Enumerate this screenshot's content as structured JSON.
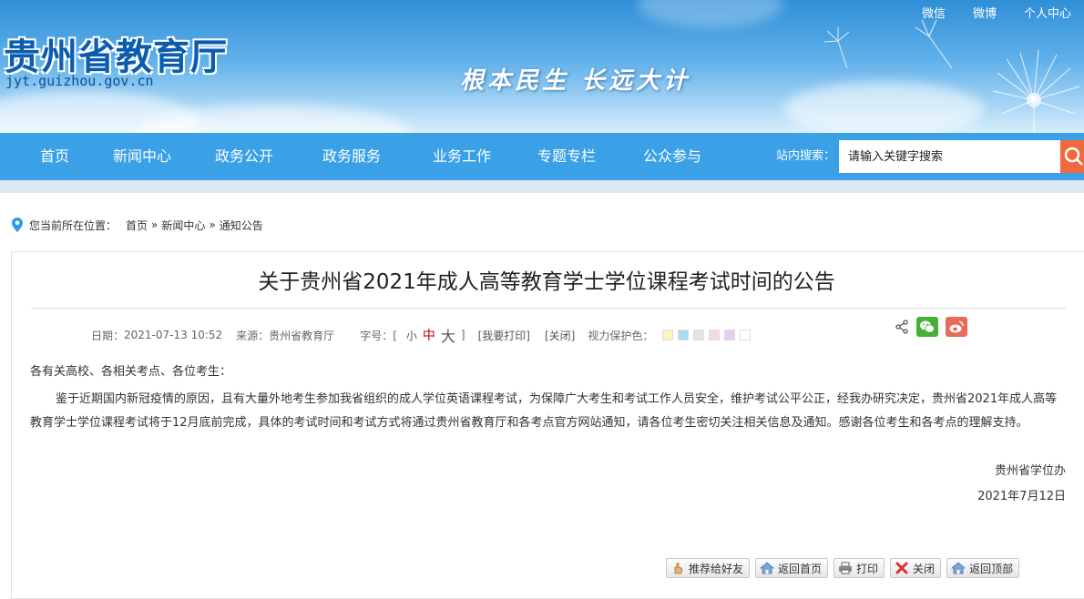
{
  "header": {
    "site_name": "贵州省教育厅",
    "site_domain": "jyt.guizhou.gov.cn",
    "slogan": "根本民生 长远大计",
    "top_links": [
      "微信",
      "微博",
      "个人中心"
    ]
  },
  "nav": {
    "items": [
      "首页",
      "新闻中心",
      "政务公开",
      "政务服务",
      "业务工作",
      "专题专栏",
      "公众参与"
    ],
    "search_label": "站内搜索：",
    "search_placeholder": "请输入关键字搜索"
  },
  "breadcrumb": {
    "prefix": "您当前所在位置：",
    "items": [
      "首页",
      "新闻中心",
      "通知公告"
    ],
    "separator": "»"
  },
  "article": {
    "title": "关于贵州省2021年成人高等教育学士学位课程考试时间的公告",
    "date_label": "日期：",
    "date": "2021-07-13 10:52",
    "source_label": "来源：",
    "source": "贵州省教育厅",
    "font_label": "字号：[",
    "font_small": "小",
    "font_medium": "中",
    "font_large": "大",
    "font_close": "]",
    "print_label": "[我要打印]",
    "close_label": "[关闭]",
    "eye_label": "视力保护色：",
    "eye_colors": [
      "#fbf3c0",
      "#a8ddf2",
      "#e3e3e3",
      "#f6d9e0",
      "#e6cdf2",
      "#ffffff"
    ],
    "greeting": "各有关高校、各相关考点、各位考生：",
    "paragraph": "鉴于近期国内新冠疫情的原因，且有大量外地考生参加我省组织的成人学位英语课程考试，为保障广大考生和考试工作人员安全，维护考试公平公正，经我办研究决定，贵州省2021年成人高等教育学士学位课程考试将于12月底前完成，具体的考试时间和考试方式将通过贵州省教育厅和各考点官方网站通知，请各位考生密切关注相关信息及通知。感谢各位考生和各考点的理解支持。",
    "signature": "贵州省学位办",
    "sign_date": "2021年7月12日"
  },
  "footer_buttons": {
    "recommend": "推荐给好友",
    "home": "返回首页",
    "print": "打印",
    "close": "关闭",
    "top": "返回顶部"
  }
}
